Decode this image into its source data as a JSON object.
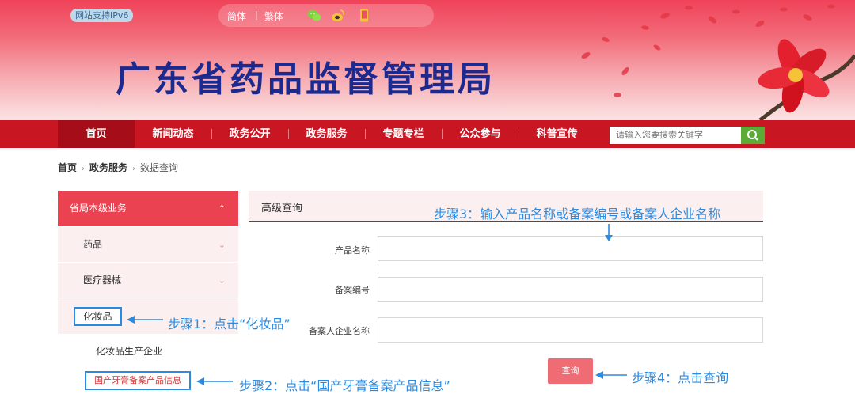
{
  "header": {
    "ipv6_badge": "网站支持IPv6",
    "lang_simplified": "简体",
    "lang_separator": "|",
    "lang_traditional": "繁体",
    "icons": [
      "wechat-icon",
      "weibo-icon",
      "mobile-icon"
    ],
    "site_title": "广东省药品监督管理局"
  },
  "nav": {
    "items": [
      "首页",
      "新闻动态",
      "政务公开",
      "政务服务",
      "专题专栏",
      "公众参与",
      "科普宣传"
    ],
    "search_placeholder": "请输入您要搜索关键字"
  },
  "breadcrumb": {
    "home": "首页",
    "section": "政务服务",
    "current": "数据查询",
    "separator": "›"
  },
  "sidebar": {
    "header": "省局本级业务",
    "items": [
      "药品",
      "医疗器械",
      "化妆品"
    ],
    "subitems": [
      "化妆品生产企业",
      "国产牙膏备案产品信息"
    ],
    "chevron_up": "⌃",
    "chevron_down": "⌄"
  },
  "form": {
    "title": "高级查询",
    "fields": [
      {
        "label": "产品名称",
        "value": ""
      },
      {
        "label": "备案编号",
        "value": ""
      },
      {
        "label": "备案人企业名称",
        "value": ""
      }
    ],
    "submit_label": "查询"
  },
  "annotations": {
    "step1": "步骤1：点击“化妆品”",
    "step2": "步骤2：点击“国产牙膏备案产品信息”",
    "step3": "步骤3：输入产品名称或备案编号或备案人企业名称",
    "step4": "步骤4：点击查询"
  },
  "colors": {
    "nav_red": "#c81623",
    "sidebar_header": "#ea4250",
    "annotation_blue": "#2c8be0",
    "title_blue": "#1c2a8f",
    "search_green": "#5cab37"
  }
}
